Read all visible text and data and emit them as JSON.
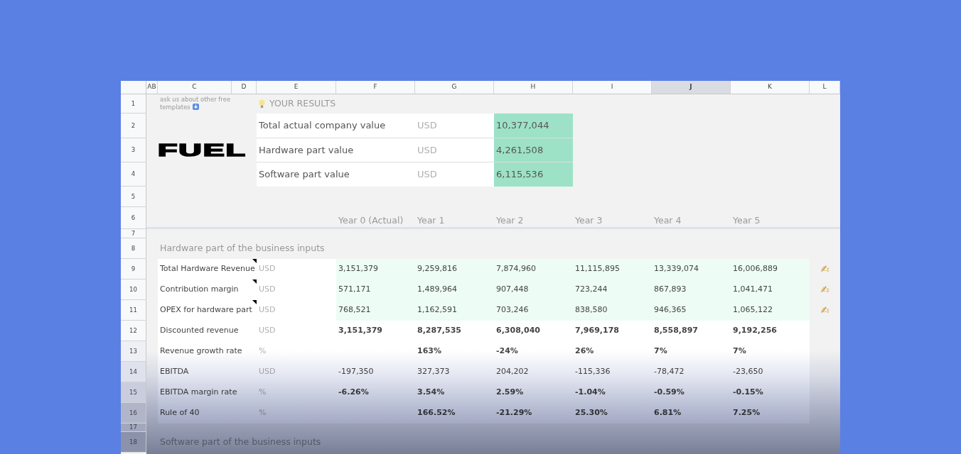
{
  "column_headers": [
    {
      "label": "AB",
      "selected": false
    },
    {
      "label": "C",
      "selected": false
    },
    {
      "label": "D",
      "selected": false
    },
    {
      "label": "E",
      "selected": false
    },
    {
      "label": "F",
      "selected": false
    },
    {
      "label": "G",
      "selected": false
    },
    {
      "label": "H",
      "selected": false
    },
    {
      "label": "I",
      "selected": false
    },
    {
      "label": "J",
      "selected": true
    },
    {
      "label": "K",
      "selected": false
    },
    {
      "label": "L",
      "selected": false
    }
  ],
  "row_numbers": [
    "1",
    "2",
    "3",
    "4",
    "5",
    "6",
    "7",
    "8",
    "9",
    "10",
    "11",
    "12",
    "13",
    "14",
    "15",
    "16",
    "17",
    "18"
  ],
  "note": "ask us about other free templates",
  "logo": "FUEL",
  "results": {
    "title": "YOUR RESULTS",
    "rows": [
      {
        "label": "Total actual company value",
        "unit": "USD",
        "value": "10,377,044"
      },
      {
        "label": "Hardware part value",
        "unit": "USD",
        "value": "4,261,508"
      },
      {
        "label": "Software part value",
        "unit": "USD",
        "value": "6,115,536"
      }
    ]
  },
  "years": [
    "Year 0 (Actual)",
    "Year 1",
    "Year 2",
    "Year 3",
    "Year 4",
    "Year 5"
  ],
  "sections": [
    {
      "title": "Hardware part of the business inputs",
      "rows": [
        {
          "kind": "input",
          "label": "Total Hardware Revenue",
          "unit": "USD",
          "has_comment": true,
          "values": [
            "3,151,379",
            "9,259,816",
            "7,874,960",
            "11,115,895",
            "13,339,074",
            "16,006,889"
          ],
          "edit_mark": "✍"
        },
        {
          "kind": "input",
          "label": "Contribution margin",
          "unit": "USD",
          "has_comment": true,
          "values": [
            "571,171",
            "1,489,964",
            "907,448",
            "723,244",
            "867,893",
            "1,041,471"
          ],
          "edit_mark": "✍"
        },
        {
          "kind": "input",
          "label": "OPEX for hardware part",
          "unit": "USD",
          "has_comment": true,
          "values": [
            "768,521",
            "1,162,591",
            "703,246",
            "838,580",
            "946,365",
            "1,065,122"
          ],
          "edit_mark": "✍"
        },
        {
          "kind": "bold",
          "label": "Discounted revenue",
          "unit": "USD",
          "has_comment": false,
          "values": [
            "3,151,379",
            "8,287,535",
            "6,308,040",
            "7,969,178",
            "8,558,897",
            "9,192,256"
          ]
        },
        {
          "kind": "bold",
          "label": "Revenue growth rate",
          "unit": "%",
          "has_comment": false,
          "has_year_0": false,
          "values": [
            "163%",
            "-24%",
            "26%",
            "7%",
            "7%"
          ]
        },
        {
          "kind": "plain",
          "label": "EBITDA",
          "unit": "USD",
          "has_comment": false,
          "values": [
            "-197,350",
            "327,373",
            "204,202",
            "-115,336",
            "-78,472",
            "-23,650"
          ]
        },
        {
          "kind": "bold",
          "label": "EBITDA margin rate",
          "unit": "%",
          "has_comment": false,
          "values": [
            "-6.26%",
            "3.54%",
            "2.59%",
            "-1.04%",
            "-0.59%",
            "-0.15%"
          ]
        },
        {
          "kind": "bold",
          "label": "Rule of 40",
          "unit": "%",
          "has_comment": false,
          "has_year_0": false,
          "values": [
            "166.52%",
            "-21.29%",
            "25.30%",
            "6.81%",
            "7.25%"
          ]
        }
      ]
    },
    {
      "title": "Software part of the business inputs"
    }
  ]
}
